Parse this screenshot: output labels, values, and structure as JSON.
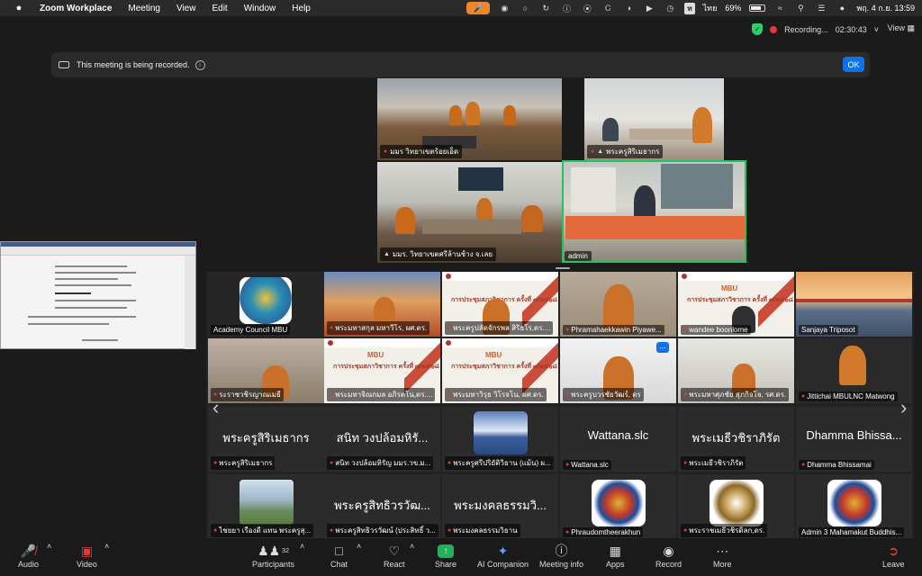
{
  "menubar": {
    "app_name": "Zoom Workplace",
    "menus": [
      "Meeting",
      "View",
      "Edit",
      "Window",
      "Help"
    ],
    "keyboard": "ท",
    "language": "ไทย",
    "battery": "69%",
    "datetime": "พฤ. 4 ก.ย.  13:59"
  },
  "topbar": {
    "recording": "Recording...",
    "timer": "02:30:43",
    "view": "View"
  },
  "banner": {
    "text": "This meeting is being recorded.",
    "ok": "OK"
  },
  "rooms": [
    {
      "name": "มมร วิทยาเขตร้อยเอ็ด"
    },
    {
      "name": "พระครูสิริเมธากร"
    },
    {
      "name": "มมร. วิทยาเขตศรีล้านช้าง จ.เลย"
    },
    {
      "name": "admin"
    }
  ],
  "gallery": {
    "slide_brand": "MBU",
    "slide_title": "การประชุมสภาวิชาการ ครั้งที่ ๗/๒๕๖๘",
    "rows": [
      [
        {
          "name": "Academy Council MBU"
        },
        {
          "name": "พระมหาสกุล มหาวีโร, ผศ.ดร."
        },
        {
          "name": "พระครูปลัดจักรพล สิริธโร,ดร...."
        },
        {
          "name": "Phramahaekkawin Piyawe..."
        },
        {
          "name": "wandee boonlome"
        },
        {
          "name": "Sanjaya Triposot"
        }
      ],
      [
        {
          "name": "ระราชวชิรญาณเมธี"
        },
        {
          "name": "พระมหาจิณกมล อภิรตโน,ดร...."
        },
        {
          "name": "พระมหาวิรุธ วิโรจโน, ผศ.ดร."
        },
        {
          "name": "พระครูบวรชัยวัฒร์, ดร"
        },
        {
          "name": "พระมหาศุภชัย สุภกิจโจ, รศ.ดร."
        },
        {
          "name": "Jittichai MBULNC Matwong"
        }
      ],
      [
        {
          "big": "พระครูสิริเมธากร",
          "name": "พระครูสิริเมธากร"
        },
        {
          "big": "สนิท  วงปล้อมหิรั...",
          "name": "สนิท  วงปล้อมหิรัญ มมร.วข.ม..."
        },
        {
          "big": "",
          "name": "พระครูศรีปริยัติวิธาน (แม้น) ผ..."
        },
        {
          "big": "Wattana.slc",
          "name": "Wattana.slc"
        },
        {
          "big": "พระเมธีวชิราภิรัต",
          "name": "พระเมธีวชิราภิรัต"
        },
        {
          "big": "Dhamma Bhissa...",
          "name": "Dhamma Bhissamai"
        }
      ],
      [
        {
          "big": "",
          "name": "ไชยยา  เรืองดี  แทน  พระครูสุ..."
        },
        {
          "big": "พระครูสิทธิวรวัฒ...",
          "name": "พระครูสิทธิวรวัฒน์ (ประสิทธิ์ ว..."
        },
        {
          "big": "พระมงคลธรรมวิ...",
          "name": "พระมงคลธรรมวิธาน"
        },
        {
          "big": "",
          "name": "Phraudomtheerakhun"
        },
        {
          "big": "",
          "name": "พระราชเมธีวชิรดิลก,ดร."
        },
        {
          "big": "",
          "name": "Admin 3 Mahamakut Buddhis..."
        }
      ]
    ]
  },
  "toolbar": {
    "audio": "Audio",
    "video": "Video",
    "participants": "Participants",
    "participants_count": "32",
    "chat": "Chat",
    "react": "React",
    "share": "Share",
    "ai": "AI Companion",
    "info": "Meeting info",
    "apps": "Apps",
    "record": "Record",
    "more": "More",
    "leave": "Leave"
  }
}
